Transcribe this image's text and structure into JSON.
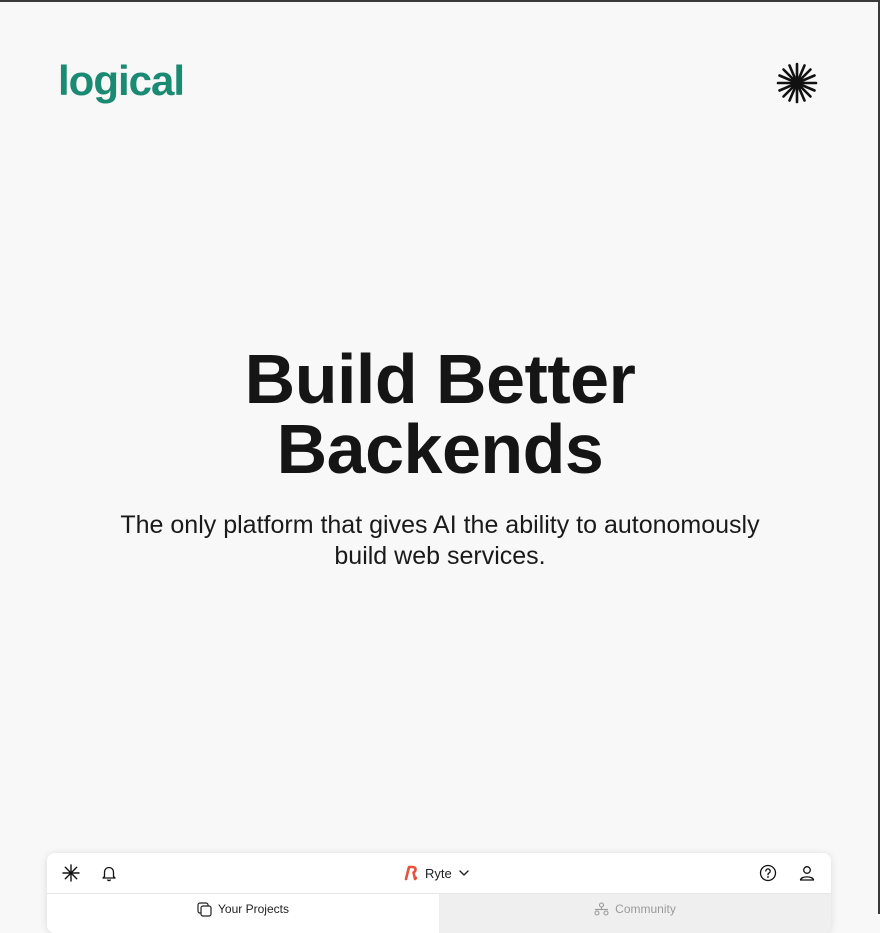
{
  "brand": {
    "logo_text": "logical",
    "logo_color": "#1b8a73",
    "menu_icon": "sparkle-icon"
  },
  "hero": {
    "title_line1": "Build Better",
    "title_line2": "Backends",
    "subtitle_line1": "The only platform that gives AI the ability to autonomously",
    "subtitle_line2": "build web services."
  },
  "app_preview": {
    "header": {
      "left_icons": [
        "sparkle-icon",
        "bell-icon"
      ],
      "org_name": "Ryte",
      "org_icon": "ryte-logo-icon",
      "org_icon_color": "#e5533d",
      "right_icons": [
        "help-circle-icon",
        "user-icon"
      ]
    },
    "tabs": [
      {
        "label": "Your Projects",
        "icon": "projects-icon",
        "active": true
      },
      {
        "label": "Community",
        "icon": "community-icon",
        "active": false
      }
    ]
  }
}
